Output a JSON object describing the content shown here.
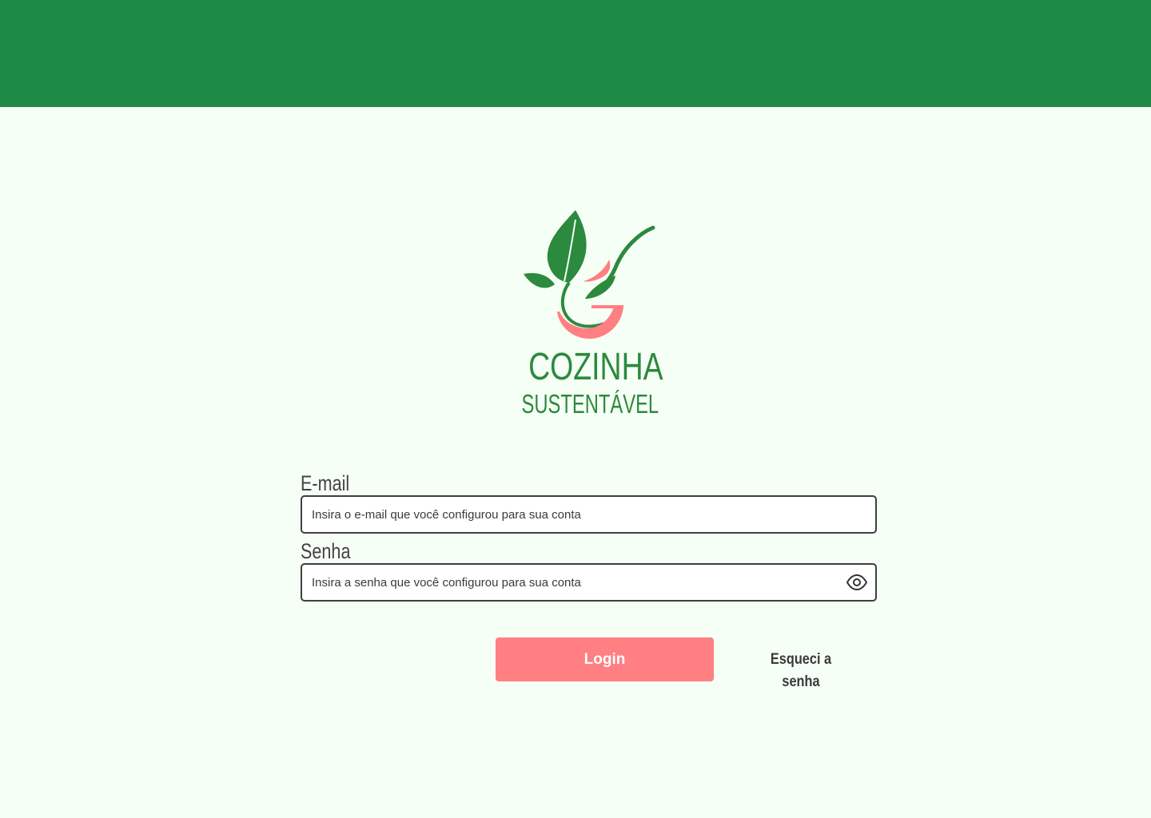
{
  "brand": {
    "title": "COZINHA",
    "subtitle": "SUSTENTÁVEL",
    "logo_icon": "leaf-spoon-bowl-icon",
    "colors": {
      "green": "#2b8a3e",
      "pink": "#ff7f83",
      "header": "#1e8a47",
      "background": "#f6fff5"
    }
  },
  "form": {
    "email": {
      "label": "E-mail",
      "placeholder": "Insira o e-mail que você configurou para sua conta",
      "value": ""
    },
    "password": {
      "label": "Senha",
      "placeholder": "Insira a senha que você configurou para sua conta",
      "value": "",
      "toggle_icon": "eye-icon"
    },
    "login_label": "Login",
    "forgot_label": "Esqueci a senha"
  }
}
